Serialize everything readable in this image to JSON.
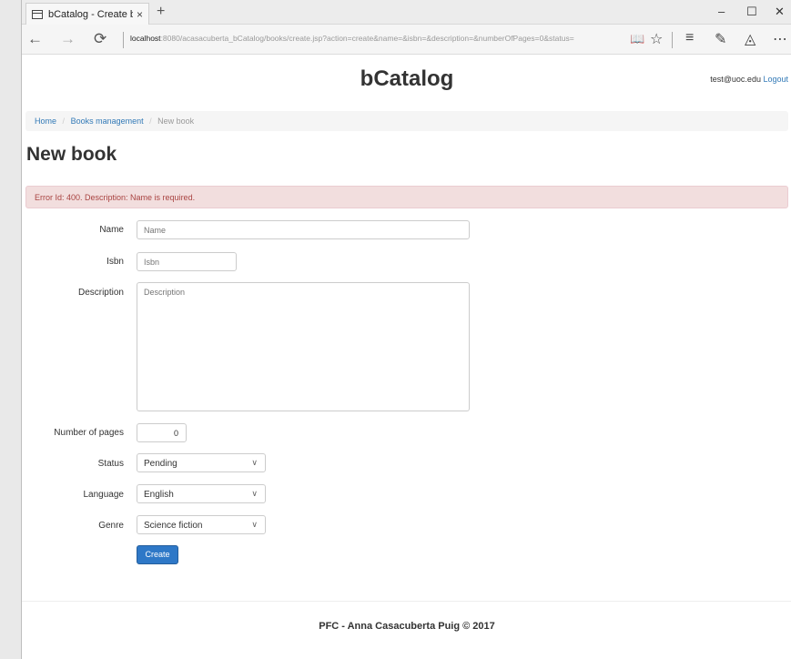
{
  "browser": {
    "tab_title": "bCatalog - Create book",
    "tab_close": "×",
    "new_tab": "+",
    "window_controls": {
      "minimize": "–",
      "maximize": "☐",
      "close": "✕"
    },
    "nav": {
      "back": "←",
      "forward": "→",
      "refresh": "⟳"
    },
    "url_host": "localhost",
    "url_rest": ":8080/acasacuberta_bCatalog/books/create.jsp?action=create&name=&isbn=&description=&numberOfPages=0&status=",
    "toolbar": {
      "reading_view": "📖",
      "favorite": "☆",
      "hub": "≡",
      "notes": "✎",
      "share": "◬",
      "more": "⋯"
    }
  },
  "header": {
    "site_title": "bCatalog",
    "user_email": "test@uoc.edu",
    "logout_label": "Logout"
  },
  "breadcrumb": {
    "home": "Home",
    "separator": "/",
    "books_management": "Books management",
    "current": "New book"
  },
  "page_title": "New book",
  "alert": {
    "text": "Error Id: 400. Description: Name is required."
  },
  "form": {
    "name": {
      "label": "Name",
      "placeholder": "Name",
      "value": ""
    },
    "isbn": {
      "label": "Isbn",
      "placeholder": "Isbn",
      "value": ""
    },
    "description": {
      "label": "Description",
      "placeholder": "Description",
      "value": ""
    },
    "number_of_pages": {
      "label": "Number of pages",
      "value": "0"
    },
    "status": {
      "label": "Status",
      "selected": "Pending"
    },
    "language": {
      "label": "Language",
      "selected": "English"
    },
    "genre": {
      "label": "Genre",
      "selected": "Science fiction"
    },
    "select_chevron": "∨",
    "submit_label": "Create"
  },
  "footer": {
    "text": "PFC - Anna Casacuberta Puig © 2017"
  },
  "colors": {
    "link": "#337ab7",
    "alert_bg": "#f2dede",
    "alert_text": "#a94442",
    "primary_button": "#2e78c7"
  }
}
